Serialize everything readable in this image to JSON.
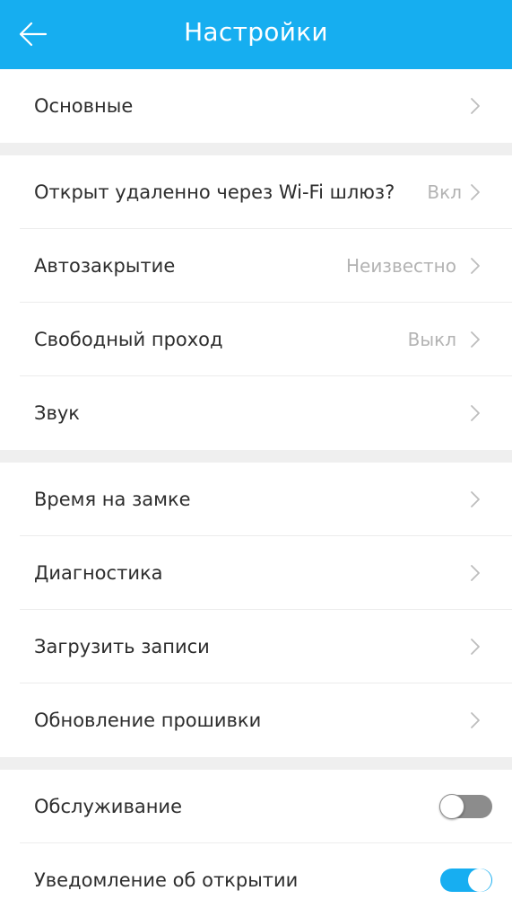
{
  "header": {
    "title": "Настройки",
    "background": "#16aef0",
    "back_icon": "arrow-left-icon"
  },
  "sections": [
    {
      "rows": [
        {
          "label": "Основные",
          "value": "",
          "trailing": "chevron-right-icon"
        }
      ]
    },
    {
      "rows": [
        {
          "label": "Открыт удаленно через Wi-Fi шлюз?",
          "value": "Вкл",
          "trailing": "chevron-right-icon"
        },
        {
          "label": "Автозакрытие",
          "value": "Неизвестно",
          "trailing": "chevron-right-icon"
        },
        {
          "label": "Свободный проход",
          "value": "Выкл",
          "trailing": "chevron-right-icon"
        },
        {
          "label": "Звук",
          "value": "",
          "trailing": "chevron-right-icon"
        }
      ]
    },
    {
      "rows": [
        {
          "label": "Время на замке",
          "value": "",
          "trailing": "chevron-right-icon"
        },
        {
          "label": "Диагностика",
          "value": "",
          "trailing": "chevron-right-icon"
        },
        {
          "label": "Загрузить записи",
          "value": "",
          "trailing": "chevron-right-icon"
        },
        {
          "label": "Обновление прошивки",
          "value": "",
          "trailing": "chevron-right-icon"
        }
      ]
    },
    {
      "rows": [
        {
          "label": "Обслуживание",
          "toggle": false
        },
        {
          "label": "Уведомление об открытии",
          "toggle": true
        }
      ]
    }
  ],
  "colors": {
    "accent": "#16aef0",
    "toggle_off": "#8c8c8c",
    "value_text": "#b3b3b3",
    "section_gap": "#efefef"
  }
}
